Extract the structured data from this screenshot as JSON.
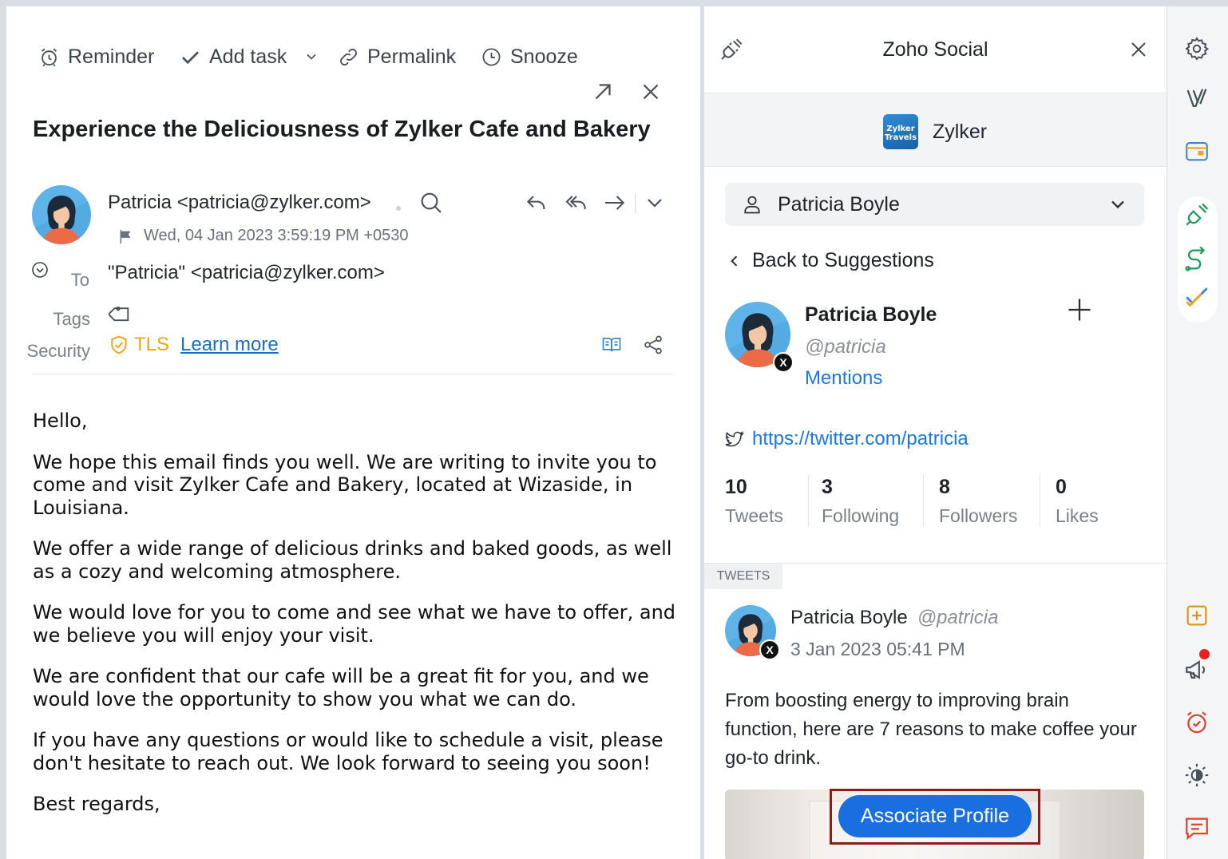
{
  "email": {
    "toolbar": {
      "reminder": "Reminder",
      "add_task": "Add task",
      "permalink": "Permalink",
      "snooze": "Snooze"
    },
    "subject": "Experience the Deliciousness of Zylker Cafe and Bakery",
    "sender": "Patricia <patricia@zylker.com>",
    "date": "Wed, 04 Jan 2023 3:59:19 PM +0530",
    "to_label": "To",
    "to_value": "\"Patricia\" <patricia@zylker.com>",
    "tags_label": "Tags",
    "security_label": "Security",
    "tls": "TLS",
    "learn_more": "Learn more",
    "body": [
      "Hello,",
      "We hope this email finds you well. We are writing to invite you to come and visit Zylker Cafe and Bakery, located at Wizaside, in Louisiana.",
      "We offer a wide range of delicious drinks and baked goods, as well as a cozy and welcoming atmosphere.",
      "We would love for you to come and see what we have to offer, and we believe you will enjoy your visit.",
      "We are confident that our cafe will be a great fit for you, and we would love the opportunity to show you what we can do.",
      "If you have any questions or would like to schedule a visit, please don't hesitate to reach out. We look forward to seeing you soon!",
      "Best regards,"
    ]
  },
  "social": {
    "title": "Zoho Social",
    "brand_logo_text": "Zylker Travels",
    "brand_name": "Zylker",
    "selected_profile": "Patricia Boyle",
    "back_link": "Back to Suggestions",
    "profile": {
      "name": "Patricia Boyle",
      "handle": "@patricia",
      "mentions": "Mentions",
      "url": "https://twitter.com/patricia",
      "badge": "X"
    },
    "stats": [
      {
        "num": "10",
        "label": "Tweets"
      },
      {
        "num": "3",
        "label": "Following"
      },
      {
        "num": "8",
        "label": "Followers"
      },
      {
        "num": "0",
        "label": "Likes"
      }
    ],
    "tweets_tab": "TWEETS",
    "tweet": {
      "name": "Patricia Boyle",
      "handle": "@patricia",
      "date": "3 Jan 2023 05:41 PM",
      "text": "From boosting energy to improving brain function, here are 7 reasons to make coffee your go-to drink."
    },
    "associate_button": "Associate Profile"
  },
  "rail": {
    "icons": [
      "gear-icon",
      "v-logo-icon",
      "calendar-card-icon",
      "plug-icon",
      "route-icon",
      "checkmark-icon",
      "add-note-icon",
      "megaphone-icon",
      "alarm-icon",
      "theme-toggle-icon",
      "chat-icon"
    ],
    "accent": "#e8211e"
  },
  "colors": {
    "accent_blue": "#1a6fe0",
    "link_blue": "#1a78e0",
    "tls_orange": "#f0a21b",
    "highlight_frame": "#8b1c1c"
  }
}
